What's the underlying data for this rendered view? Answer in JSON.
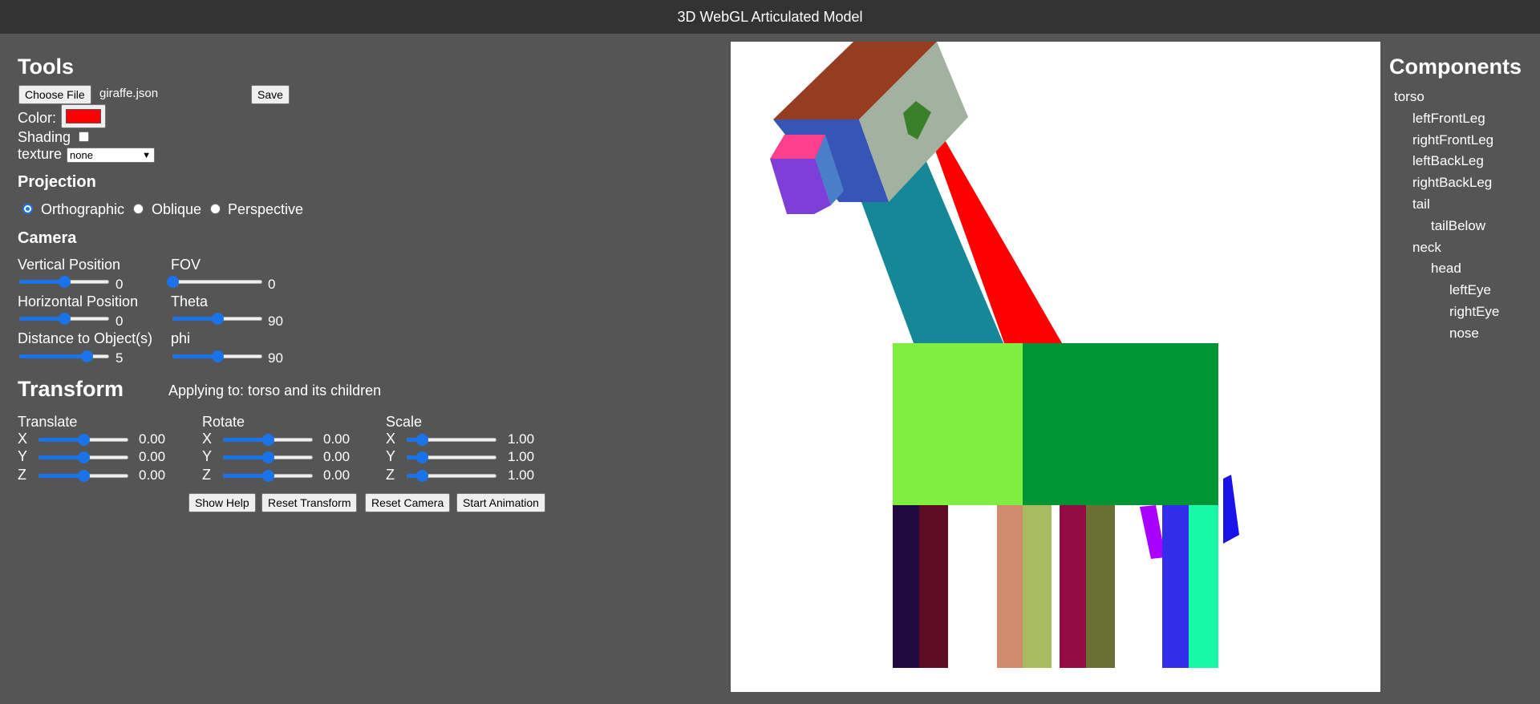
{
  "app": {
    "title": "3D WebGL Articulated Model"
  },
  "tools": {
    "heading": "Tools",
    "choose_file_label": "Choose File",
    "file_name": "giraffe.json",
    "save_label": "Save",
    "color_label": "Color:",
    "color_value": "#ff0000",
    "shading_label": "Shading",
    "shading_checked": false,
    "texture_label": "texture",
    "texture_value": "none"
  },
  "projection": {
    "heading": "Projection",
    "options": [
      {
        "label": "Orthographic",
        "selected": true
      },
      {
        "label": "Oblique",
        "selected": false
      },
      {
        "label": "Perspective",
        "selected": false
      }
    ]
  },
  "camera": {
    "heading": "Camera",
    "vertical_position": {
      "label": "Vertical Position",
      "value": "0",
      "fraction": 0.5
    },
    "horizontal_position": {
      "label": "Horizontal Position",
      "value": "0",
      "fraction": 0.5
    },
    "distance": {
      "label": "Distance to Object(s)",
      "value": "5",
      "fraction": 0.75
    },
    "fov": {
      "label": "FOV",
      "value": "0",
      "fraction": 0.0
    },
    "theta": {
      "label": "Theta",
      "value": "90",
      "fraction": 0.5
    },
    "phi": {
      "label": "phi",
      "value": "90",
      "fraction": 0.5
    }
  },
  "transform": {
    "heading": "Transform",
    "applying_to": "Applying to: torso and its children",
    "translate": {
      "label": "Translate",
      "axes": [
        {
          "axis": "X",
          "value": "0.00",
          "fraction": 0.5
        },
        {
          "axis": "Y",
          "value": "0.00",
          "fraction": 0.5
        },
        {
          "axis": "Z",
          "value": "0.00",
          "fraction": 0.5
        }
      ]
    },
    "rotate": {
      "label": "Rotate",
      "axes": [
        {
          "axis": "X",
          "value": "0.00",
          "fraction": 0.5
        },
        {
          "axis": "Y",
          "value": "0.00",
          "fraction": 0.5
        },
        {
          "axis": "Z",
          "value": "0.00",
          "fraction": 0.5
        }
      ]
    },
    "scale": {
      "label": "Scale",
      "axes": [
        {
          "axis": "X",
          "value": "1.00",
          "fraction": 0.17
        },
        {
          "axis": "Y",
          "value": "1.00",
          "fraction": 0.17
        },
        {
          "axis": "Z",
          "value": "1.00",
          "fraction": 0.17
        }
      ]
    }
  },
  "buttons": {
    "show_help": "Show Help",
    "reset_transform": "Reset Transform",
    "reset_camera": "Reset Camera",
    "start_animation": "Start Animation"
  },
  "components": {
    "heading": "Components",
    "tree": [
      {
        "name": "torso",
        "depth": 0
      },
      {
        "name": "leftFrontLeg",
        "depth": 1
      },
      {
        "name": "rightFrontLeg",
        "depth": 1
      },
      {
        "name": "leftBackLeg",
        "depth": 1
      },
      {
        "name": "rightBackLeg",
        "depth": 1
      },
      {
        "name": "tail",
        "depth": 1
      },
      {
        "name": "tailBelow",
        "depth": 2
      },
      {
        "name": "neck",
        "depth": 1
      },
      {
        "name": "head",
        "depth": 2
      },
      {
        "name": "leftEye",
        "depth": 3
      },
      {
        "name": "rightEye",
        "depth": 3
      },
      {
        "name": "nose",
        "depth": 3
      }
    ]
  },
  "model_colors": {
    "torso_front": "#80ee40",
    "torso_side": "#009435",
    "neck_front": "#168797",
    "neck_side": "#ff0000",
    "head_top": "#963c20",
    "head_front": "#a3b1a0",
    "head_side": "#3755b7",
    "eye": "#3a7f2a",
    "nose_top": "#ff3e8c",
    "nose_front": "#7e3ed8",
    "nose_side": "#4a7ec8"
  }
}
